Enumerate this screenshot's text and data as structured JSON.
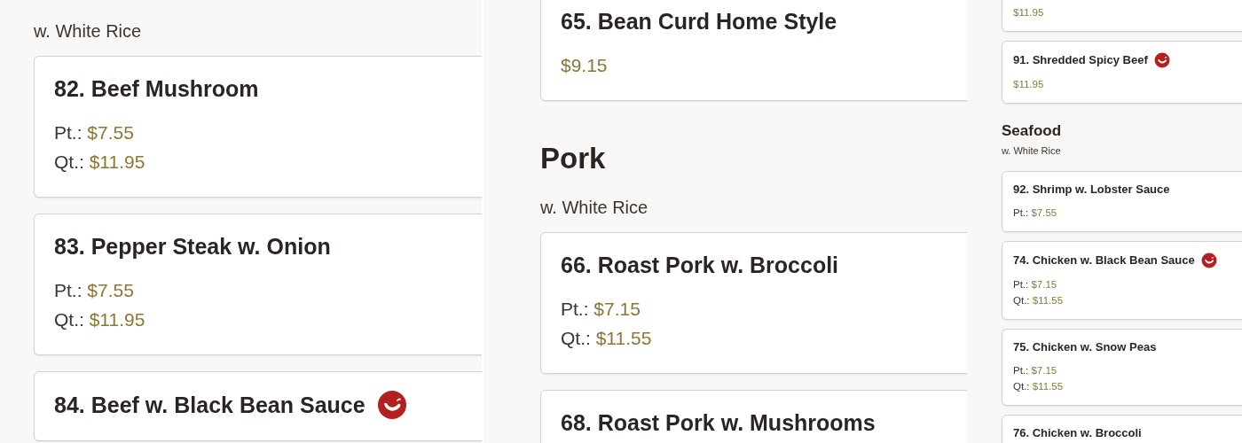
{
  "panels": [
    {
      "blocks": [
        {
          "kind": "subtitle",
          "text": "w. White Rice"
        },
        {
          "kind": "dish",
          "name": "82. Beef Mushroom",
          "spicy": false,
          "prices": [
            {
              "label": "Pt.:",
              "price": "$7.55"
            },
            {
              "label": "Qt.:",
              "price": "$11.95"
            }
          ]
        },
        {
          "kind": "dish",
          "name": "83. Pepper Steak w. Onion",
          "spicy": false,
          "prices": [
            {
              "label": "Pt.:",
              "price": "$7.55"
            },
            {
              "label": "Qt.:",
              "price": "$11.95"
            }
          ]
        },
        {
          "kind": "dish",
          "name": "84. Beef w. Black Bean Sauce",
          "spicy": true
        }
      ]
    },
    {
      "blocks": [
        {
          "kind": "dish",
          "name": "65. Bean Curd Home Style",
          "spicy": false,
          "prices": [
            {
              "price": "$9.15"
            }
          ]
        },
        {
          "kind": "heading",
          "text": "Pork"
        },
        {
          "kind": "subtitle",
          "text": "w. White Rice"
        },
        {
          "kind": "dish",
          "name": "66. Roast Pork w. Broccoli",
          "spicy": false,
          "prices": [
            {
              "label": "Pt.:",
              "price": "$7.15"
            },
            {
              "label": "Qt.:",
              "price": "$11.55"
            }
          ]
        },
        {
          "kind": "dish",
          "name": "68. Roast Pork w. Mushrooms",
          "spicy": false
        }
      ]
    },
    {
      "blocks": [
        {
          "kind": "dish",
          "spicy": false,
          "prices": [
            {
              "price": "$11.95"
            }
          ]
        },
        {
          "kind": "dish",
          "name": "91. Shredded Spicy Beef",
          "spicy": true,
          "prices": [
            {
              "price": "$11.95"
            }
          ]
        },
        {
          "kind": "heading",
          "text": "Seafood"
        },
        {
          "kind": "subtitle",
          "text": "w. White Rice"
        },
        {
          "kind": "dish",
          "name": "92. Shrimp w. Lobster Sauce",
          "spicy": false,
          "prices": [
            {
              "label": "Pt.:",
              "price": "$7.55"
            }
          ]
        },
        {
          "kind": "dish",
          "name": "74. Chicken w. Black Bean Sauce",
          "spicy": true,
          "prices": [
            {
              "label": "Pt.:",
              "price": "$7.15"
            },
            {
              "label": "Qt.:",
              "price": "$11.55"
            }
          ]
        },
        {
          "kind": "dish",
          "name": "75. Chicken w. Snow Peas",
          "spicy": false,
          "prices": [
            {
              "label": "Pt.:",
              "price": "$7.15"
            },
            {
              "label": "Qt.:",
              "price": "$11.55"
            }
          ]
        },
        {
          "kind": "dish",
          "name": "76. Chicken w. Broccoli",
          "spicy": false
        }
      ]
    }
  ]
}
